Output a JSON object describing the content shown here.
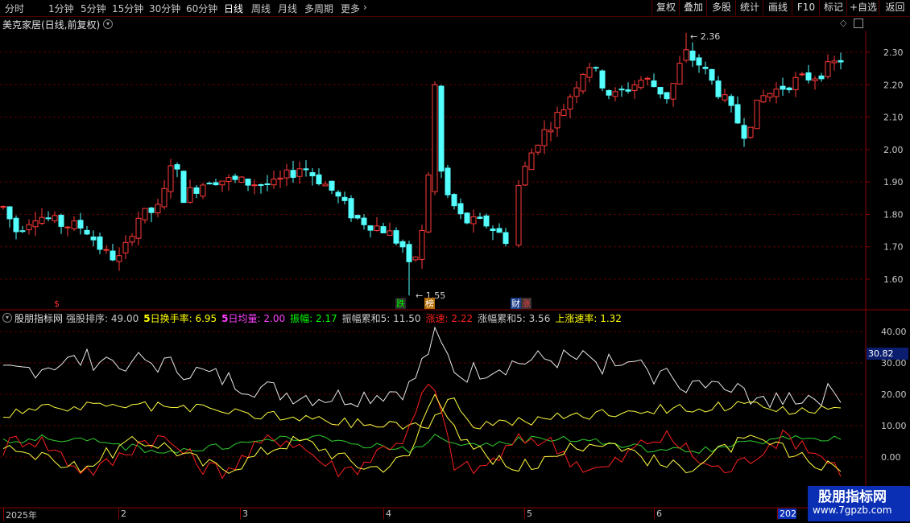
{
  "toolbar": {
    "periods": [
      "分时",
      "1分钟",
      "5分钟",
      "15分钟",
      "30分钟",
      "60分钟",
      "日线",
      "周线",
      "月线",
      "多周期",
      "更多"
    ],
    "active_period": "日线",
    "right_buttons": [
      "复权",
      "叠加",
      "多股",
      "统计",
      "画线",
      "F10",
      "标记",
      "+自选",
      "返回"
    ]
  },
  "main_chart": {
    "title": "美克家居(日线,前复权)",
    "y_ticks": [
      "2.30",
      "2.20",
      "2.10",
      "2.00",
      "1.90",
      "1.80",
      "1.70",
      "1.60"
    ],
    "high_label": "2.36",
    "low_label": "1.55",
    "markers": [
      {
        "text": "$",
        "color": "#ff3030"
      },
      {
        "text": "跌",
        "color": "#00ff00",
        "bg": "#2a2a2a"
      },
      {
        "text": "榜",
        "color": "#ffffff",
        "bg": "#b36b00"
      },
      {
        "text": "财",
        "color": "#ffffff",
        "bg": "#1c3d8a"
      },
      {
        "text": "涨",
        "color": "#ff4040",
        "bg": "#333333"
      }
    ],
    "colors": {
      "up": "#ff3a3a",
      "down": "#54ffff",
      "grid": "#5a0000",
      "axis": "#8b0000"
    }
  },
  "indicator": {
    "name": "股朋指标网",
    "items": [
      {
        "label": "强股排序",
        "value": "49.00",
        "color": "#c8c8c8"
      },
      {
        "label": "5日换手率",
        "value": "6.95",
        "color": "#ffff00",
        "prefix": "5",
        "prefix_color": "#ffff00"
      },
      {
        "label": "5日均量",
        "value": "2.00",
        "color": "#ff40ff",
        "prefix": "5",
        "prefix_color": "#ff40ff"
      },
      {
        "label": "振幅",
        "value": "2.17",
        "color": "#00ff00"
      },
      {
        "label": "振幅累和5",
        "value": "11.50",
        "color": "#c8c8c8"
      },
      {
        "label": "涨速",
        "value": "2.22",
        "color": "#ff2020"
      },
      {
        "label": "涨幅累和5",
        "value": "3.56",
        "color": "#c8c8c8"
      },
      {
        "label": "上涨速率",
        "value": "1.32",
        "color": "#ffff00"
      }
    ],
    "y_ticks": [
      "40.00",
      "30.00",
      "20.00",
      "10.00",
      "0.00"
    ],
    "current_value": "30.82"
  },
  "x_axis": {
    "labels": [
      "2025年",
      "2",
      "3",
      "4",
      "5",
      "6",
      "202"
    ]
  },
  "watermark": {
    "title": "股朋指标网",
    "url": "www.7gpzb.com"
  }
}
